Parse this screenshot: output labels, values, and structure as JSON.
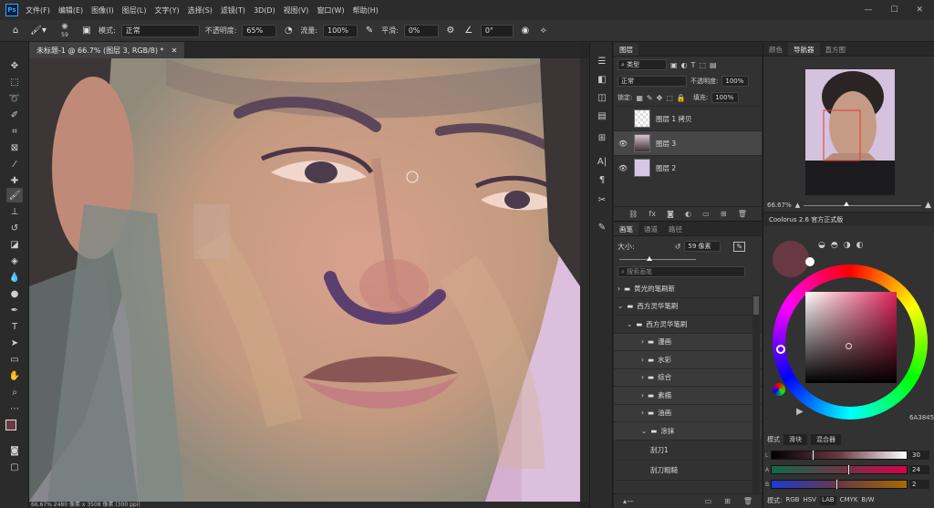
{
  "menubar": {
    "logo": "Ps",
    "items": [
      "文件(F)",
      "编辑(E)",
      "图像(I)",
      "图层(L)",
      "文字(Y)",
      "选择(S)",
      "滤镜(T)",
      "3D(D)",
      "视图(V)",
      "窗口(W)",
      "帮助(H)"
    ]
  },
  "options": {
    "brush_size": "59",
    "mode_label": "模式:",
    "mode_value": "正常",
    "opacity_label": "不透明度:",
    "opacity_value": "65%",
    "flow_label": "流量:",
    "flow_value": "100%",
    "smooth_label": "平滑:",
    "smooth_value": "0%",
    "angle_value": "0°"
  },
  "document": {
    "tab_title": "未标题-1 @ 66.7% (图层 3, RGB/8) *",
    "status": "66.67%   2480 像素 x 3508 像素 (300 ppi)"
  },
  "layers_panel": {
    "tab": "图层",
    "filter_label": "类型",
    "blend_mode": "正常",
    "opacity_label": "不透明度:",
    "opacity_value": "100%",
    "lock_label": "锁定:",
    "fill_label": "填充:",
    "fill_value": "100%",
    "layers": [
      {
        "name": "图层 1 拷贝",
        "visible": false,
        "selected": false
      },
      {
        "name": "图层 3",
        "visible": true,
        "selected": true
      },
      {
        "name": "图层 2",
        "visible": true,
        "selected": false
      }
    ]
  },
  "brush_panel": {
    "tabs": [
      "画笔",
      "通道",
      "路径"
    ],
    "size_label": "大小:",
    "size_value": "59 像素",
    "search_placeholder": "搜索画笔",
    "groups": [
      {
        "label": "黄光的笔刷新",
        "level": 0
      },
      {
        "label": "西方灵华笔刷",
        "level": 0
      },
      {
        "label": "西方灵华笔刷",
        "level": 1
      },
      {
        "label": "漫画",
        "level": 2
      },
      {
        "label": "水彩",
        "level": 2
      },
      {
        "label": "综合",
        "level": 2
      },
      {
        "label": "素描",
        "level": 2
      },
      {
        "label": "油画",
        "level": 2
      },
      {
        "label": "涂抹",
        "level": 2
      }
    ],
    "brush_items": [
      "刮刀1",
      "刮刀粗糙"
    ]
  },
  "navigator_panel": {
    "tabs": [
      "颜色",
      "导航器",
      "直方图"
    ],
    "zoom": "66.67%"
  },
  "color_panel": {
    "title": "Coolorus 2.6 官方正式版",
    "hex": "6A3845",
    "mode_label": "模式",
    "mode_buttons": [
      "滑块",
      "混合器"
    ],
    "sliders": [
      {
        "label": "L",
        "value": "30",
        "pos": 0.3
      },
      {
        "label": "A",
        "value": "24",
        "pos": 0.57
      },
      {
        "label": "B",
        "value": "2",
        "pos": 0.48
      }
    ],
    "footer_modes": [
      "模式:",
      "RGB",
      "HSV",
      "LAB",
      "CMYK",
      "B/W"
    ],
    "current_color": "#6a3845"
  }
}
